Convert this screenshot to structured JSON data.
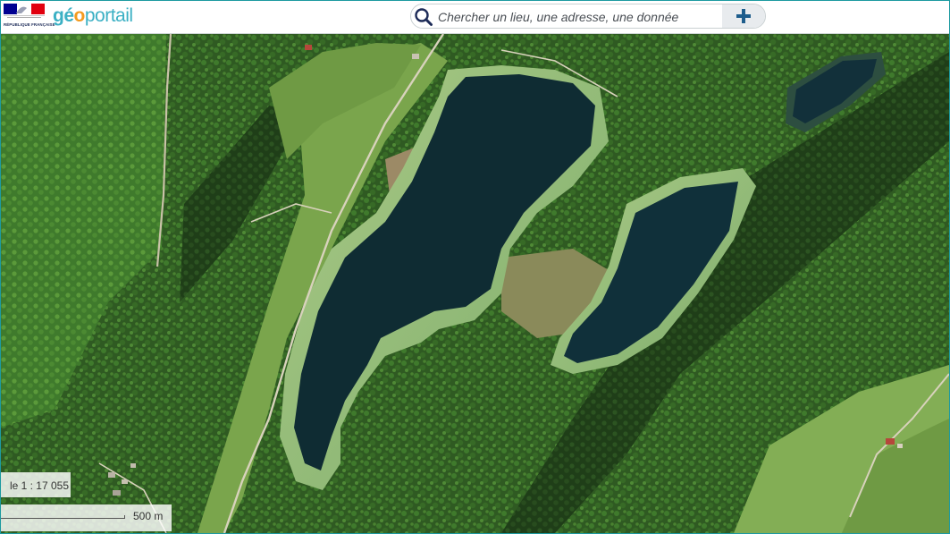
{
  "header": {
    "republic_caption": "RÉPUBLIQUE FRANÇAISE",
    "brand_part1": "gé",
    "brand_part2": "o",
    "brand_part3": "portail"
  },
  "search": {
    "placeholder": "Chercher un lieu, une adresse, une donnée",
    "value": ""
  },
  "map": {
    "layer": "aerial-photography",
    "scale_label": "le 1 : 17 055",
    "scalebar_label": "500 m"
  },
  "colors": {
    "accent": "#1d9aa0",
    "brand_blue": "#3bb0c4",
    "brand_orange": "#f39a1f",
    "forest": "#2f5a22",
    "meadow": "#6f9a44",
    "lake": "#0f2c33"
  },
  "icons": [
    "search-icon",
    "plus-icon",
    "marianne-flag-icon"
  ]
}
